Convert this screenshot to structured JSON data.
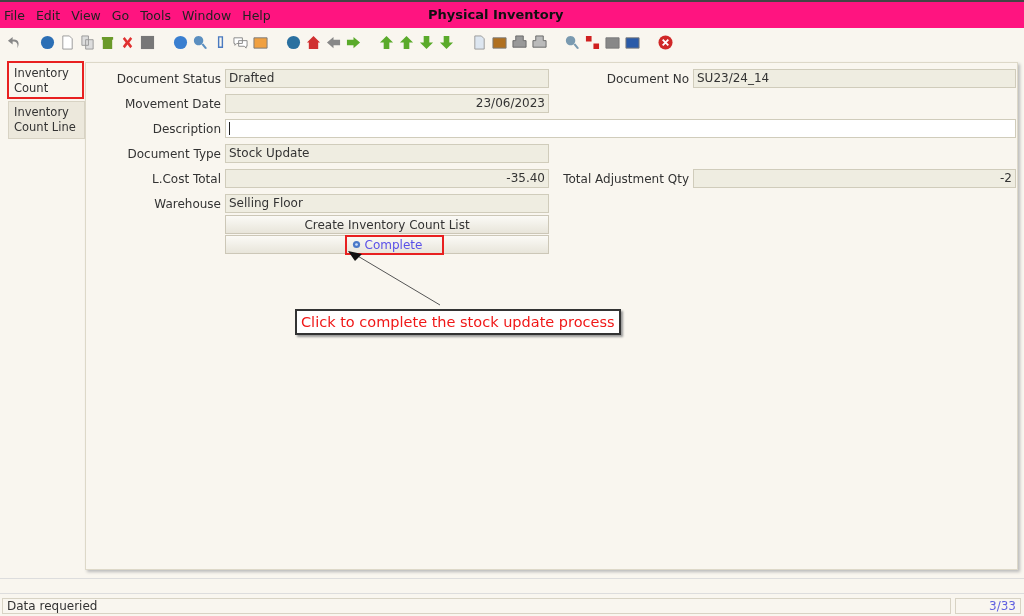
{
  "window": {
    "title": "Physical Inventory"
  },
  "menu": [
    "File",
    "Edit",
    "View",
    "Go",
    "Tools",
    "Window",
    "Help"
  ],
  "tabs": [
    {
      "label": "Inventory Count",
      "selected": true,
      "highlighted": true
    },
    {
      "label": "Inventory Count Line",
      "selected": false,
      "highlighted": false
    }
  ],
  "form": {
    "rows": [
      {
        "label": "Document Status",
        "value": "Drafted",
        "kind": "text",
        "side": {
          "label": "Document No",
          "value": "SU23/24_14",
          "kind": "text"
        }
      },
      {
        "label": "Movement Date",
        "value": "23/06/2023",
        "kind": "number"
      },
      {
        "label": "Description",
        "value": "",
        "kind": "input"
      },
      {
        "label": "Document Type",
        "value": "Stock Update",
        "kind": "text"
      },
      {
        "label": "L.Cost Total",
        "value": "-35.40",
        "kind": "number",
        "side": {
          "label": "Total Adjustment Qty",
          "value": "-2",
          "kind": "number"
        }
      },
      {
        "label": "Warehouse",
        "value": "Selling Floor",
        "kind": "text"
      }
    ],
    "buttons": [
      {
        "label": "Create Inventory Count List",
        "kind": "plain",
        "highlighted": false
      },
      {
        "label": "Complete",
        "kind": "process",
        "highlighted": true
      }
    ]
  },
  "callout": {
    "text": "Click to complete the stock update process"
  },
  "status_bar": {
    "message": "Data requeried",
    "record": "3/33"
  }
}
